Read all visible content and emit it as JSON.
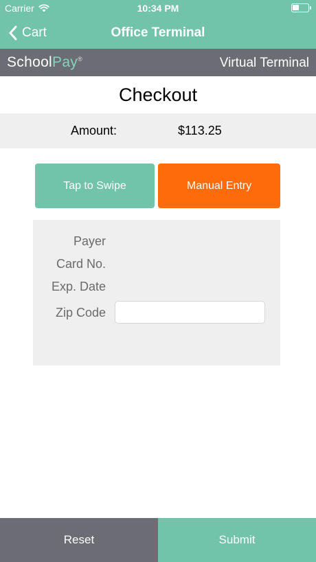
{
  "status_bar": {
    "carrier": "Carrier",
    "time": "10:34 PM"
  },
  "nav": {
    "back_label": "Cart",
    "title": "Office Terminal"
  },
  "brand": {
    "logo_part1": "School",
    "logo_part2": "Pay",
    "logo_mark": "®",
    "terminal_label": "Virtual Terminal"
  },
  "checkout": {
    "title": "Checkout",
    "amount_label": "Amount:",
    "amount_value": "$113.25",
    "tap_to_swipe": "Tap to Swipe",
    "manual_entry": "Manual Entry"
  },
  "form": {
    "payer_label": "Payer",
    "card_label": "Card No.",
    "exp_label": "Exp. Date",
    "zip_label": "Zip Code",
    "zip_value": ""
  },
  "footer": {
    "reset_label": "Reset",
    "submit_label": "Submit"
  },
  "colors": {
    "teal": "#71c3aa",
    "orange": "#fe6b0b",
    "gray_bar": "#6c6c74",
    "panel": "#efefef"
  }
}
